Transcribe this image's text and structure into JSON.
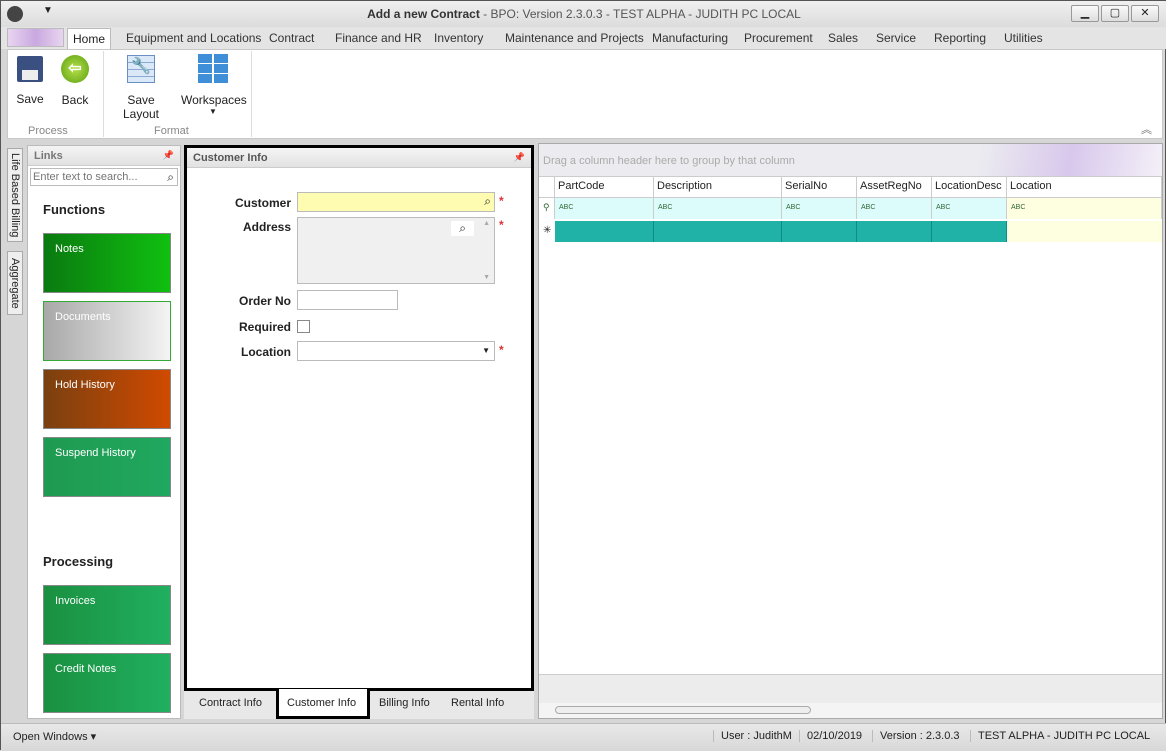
{
  "window": {
    "title_bold": "Add a new Contract",
    "title_rest": " - BPO: Version 2.3.0.3 - TEST ALPHA - JUDITH PC LOCAL",
    "min": "▁",
    "max": "▢",
    "close": "✕"
  },
  "menu_tabs": [
    "Home",
    "Equipment and Locations",
    "Contract",
    "Finance and HR",
    "Inventory",
    "Maintenance and Projects",
    "Manufacturing",
    "Procurement",
    "Sales",
    "Service",
    "Reporting",
    "Utilities"
  ],
  "ribbon": {
    "save": "Save",
    "back": "Back",
    "save_layout": "Save Layout",
    "workspaces": "Workspaces",
    "group_process": "Process",
    "group_format": "Format"
  },
  "side_tabs": [
    "Life Based Billing",
    "Aggregate"
  ],
  "links": {
    "title": "Links",
    "search_placeholder": "Enter text to search...",
    "functions": "Functions",
    "processing": "Processing",
    "function_tiles": [
      "Notes",
      "Documents",
      "Hold History",
      "Suspend History"
    ],
    "processing_tiles": [
      "Invoices",
      "Credit Notes"
    ]
  },
  "customer_info": {
    "title": "Customer Info",
    "customer": "Customer",
    "address": "Address",
    "order_no": "Order No",
    "required": "Required",
    "location": "Location",
    "required_mark": "*"
  },
  "bottom_tabs": [
    "Contract Info",
    "Customer Info",
    "Billing Info",
    "Rental Info"
  ],
  "grid": {
    "group_hint": "Drag a column header here to group by that column",
    "columns": [
      "PartCode",
      "Description",
      "SerialNo",
      "AssetRegNo",
      "LocationDesc",
      "Location"
    ],
    "filter_glyph": "ABC"
  },
  "status": {
    "open_windows": "Open Windows ▾",
    "user": "User : JudithM",
    "date": "02/10/2019",
    "version": "Version : 2.3.0.3",
    "env": "TEST ALPHA - JUDITH PC LOCAL"
  }
}
